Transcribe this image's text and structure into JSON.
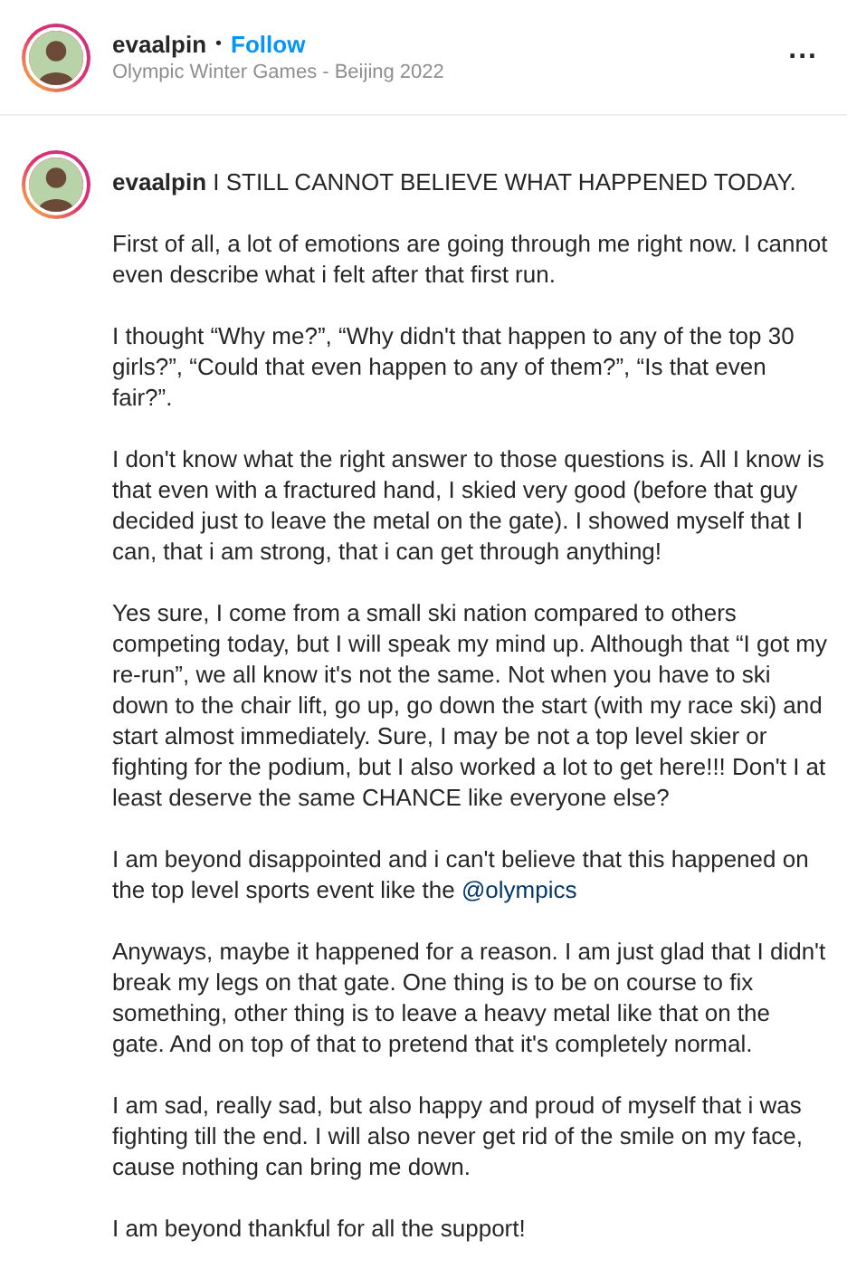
{
  "header": {
    "username": "evaalpin",
    "separator": "•",
    "follow": "Follow",
    "location": "Olympic Winter Games - Beijing 2022",
    "more": "..."
  },
  "caption": {
    "username": "evaalpin",
    "first_line": "I STILL CANNOT BELIEVE WHAT HAPPENED TODAY.",
    "paragraphs": [
      {
        "text": "First of all, a lot of emotions are going through me right now. I cannot even describe what i felt after that first run."
      },
      {
        "text": "I thought “Why me?”, “Why didn't that happen to any of the top 30 girls?”, “Could that even happen to any of them?”, “Is that even fair?”."
      },
      {
        "text": "I don't know what the right answer to those questions is. All I know is that even with a fractured hand, I skied very good (before that guy decided just to leave the metal on the gate). I showed myself that I can, that i am strong, that i can get through anything!"
      },
      {
        "text": "Yes sure, I come from a small ski nation compared to others competing today, but I will speak my mind up. Although that “I got my re-run”, we all know it's not the same. Not when you have to ski down to the chair lift, go up, go down the start (with my race ski) and start almost immediately. Sure, I may be not a top level skier or fighting for the podium, but I also worked a lot to get here!!! Don't I at least deserve the same CHANCE like everyone else?"
      },
      {
        "text": "I am beyond disappointed and i can't believe that this happened on the top level sports event like the",
        "mention": "@olympics"
      },
      {
        "text": "Anyways, maybe it happened for a reason. I am just glad that I didn't break my legs on that gate. One thing is to be on course to fix something, other thing is to leave a heavy metal like that on the gate. And on top of that to pretend that it's completely normal."
      },
      {
        "text": "I am sad, really sad, but also happy and proud of myself that i was fighting till the end. I will also never get rid of the smile on my face, cause nothing can bring me down."
      },
      {
        "text": "I am beyond thankful for all the support!"
      }
    ]
  }
}
